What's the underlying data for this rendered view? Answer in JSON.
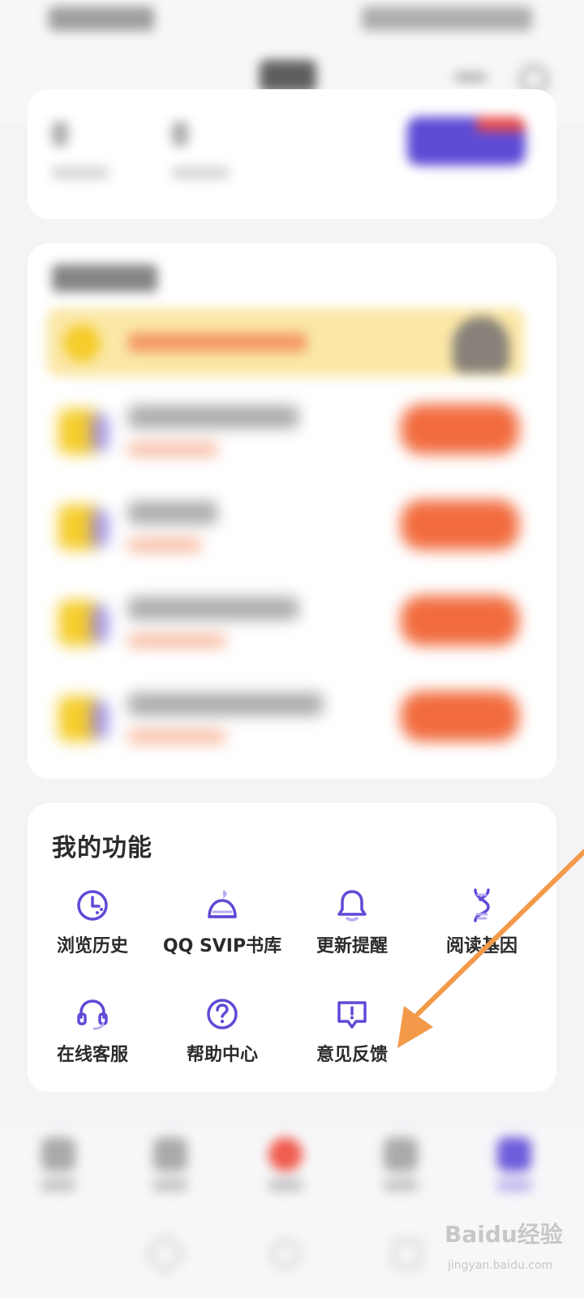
{
  "my_functions": {
    "title": "我的功能",
    "items": [
      {
        "label": "浏览历史",
        "icon": "clock-history-icon"
      },
      {
        "label": "QQ SVIP书库",
        "icon": "crown-bookshelf-icon"
      },
      {
        "label": "更新提醒",
        "icon": "bell-icon"
      },
      {
        "label": "阅读基因",
        "icon": "dna-icon"
      },
      {
        "label": "在线客服",
        "icon": "headset-icon"
      },
      {
        "label": "帮助中心",
        "icon": "question-circle-icon"
      },
      {
        "label": "意见反馈",
        "icon": "feedback-bubble-icon"
      }
    ]
  },
  "colors": {
    "accent": "#5e4bd6",
    "task_button": "#f26c3f",
    "annotation_arrow": "#f39a4a"
  },
  "watermark": {
    "main": "Baidu经验",
    "sub": "jingyan.baidu.com"
  }
}
